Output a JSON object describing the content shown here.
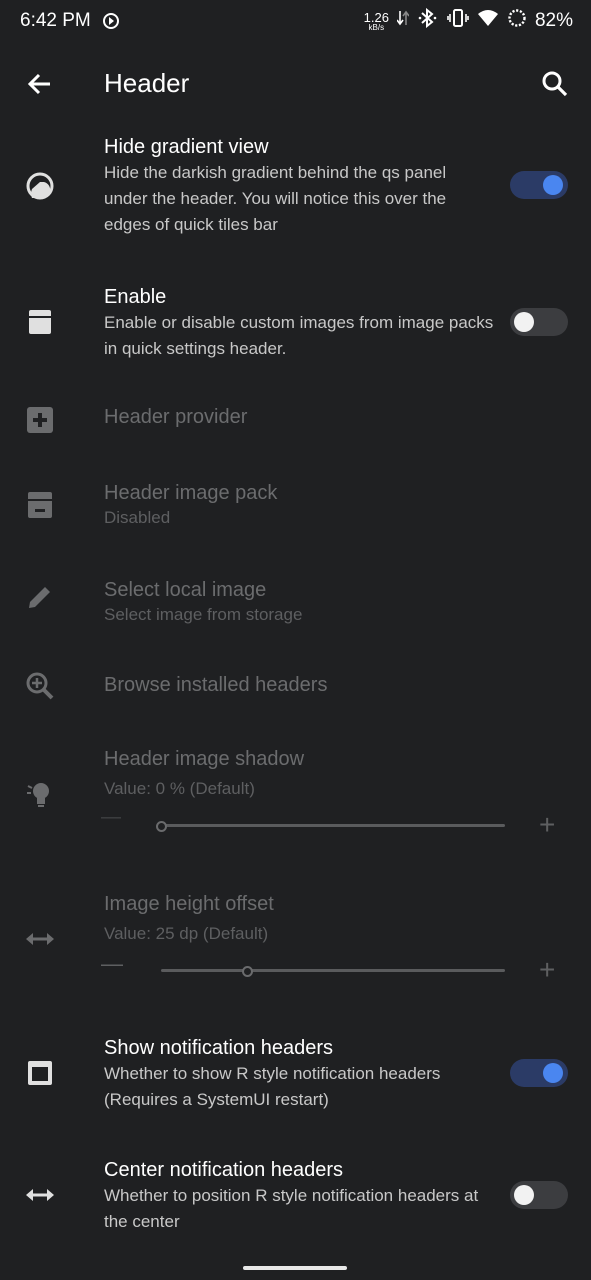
{
  "status_bar": {
    "time": "6:42 PM",
    "net_speed_value": "1.26",
    "net_speed_unit": "kB/s",
    "battery": "82%"
  },
  "appbar": {
    "title": "Header",
    "back_icon": "arrow-back-icon",
    "search_icon": "search-icon"
  },
  "items": [
    {
      "title": "Hide gradient view",
      "summary": "Hide the darkish gradient behind the qs panel under the header. You will notice this over the edges of quick tiles bar",
      "toggle": true,
      "enabled": true
    },
    {
      "title": "Enable",
      "summary": "Enable or disable custom images from image packs in quick settings header.",
      "toggle": false,
      "enabled": true
    },
    {
      "title": "Header provider",
      "enabled": false
    },
    {
      "title": "Header image pack",
      "summary": "Disabled",
      "enabled": false
    },
    {
      "title": "Select local image",
      "summary": "Select image from storage",
      "enabled": false
    },
    {
      "title": "Browse installed headers",
      "enabled": false
    },
    {
      "title": "Header image shadow",
      "summary": "Value: 0 % (Default)",
      "enabled": false,
      "slider_value": 0
    },
    {
      "title": "Image height offset",
      "summary": "Value: 25 dp (Default)",
      "enabled": false,
      "slider_value": 25
    },
    {
      "title": "Show notification headers",
      "summary": "Whether to show R style notification headers (Requires a SystemUI restart)",
      "toggle": true,
      "enabled": true
    },
    {
      "title": "Center notification headers",
      "summary": "Whether to position R style notification headers at the center",
      "toggle": false,
      "enabled": true
    }
  ],
  "slider_controls": {
    "minus": "—",
    "plus": "+"
  }
}
